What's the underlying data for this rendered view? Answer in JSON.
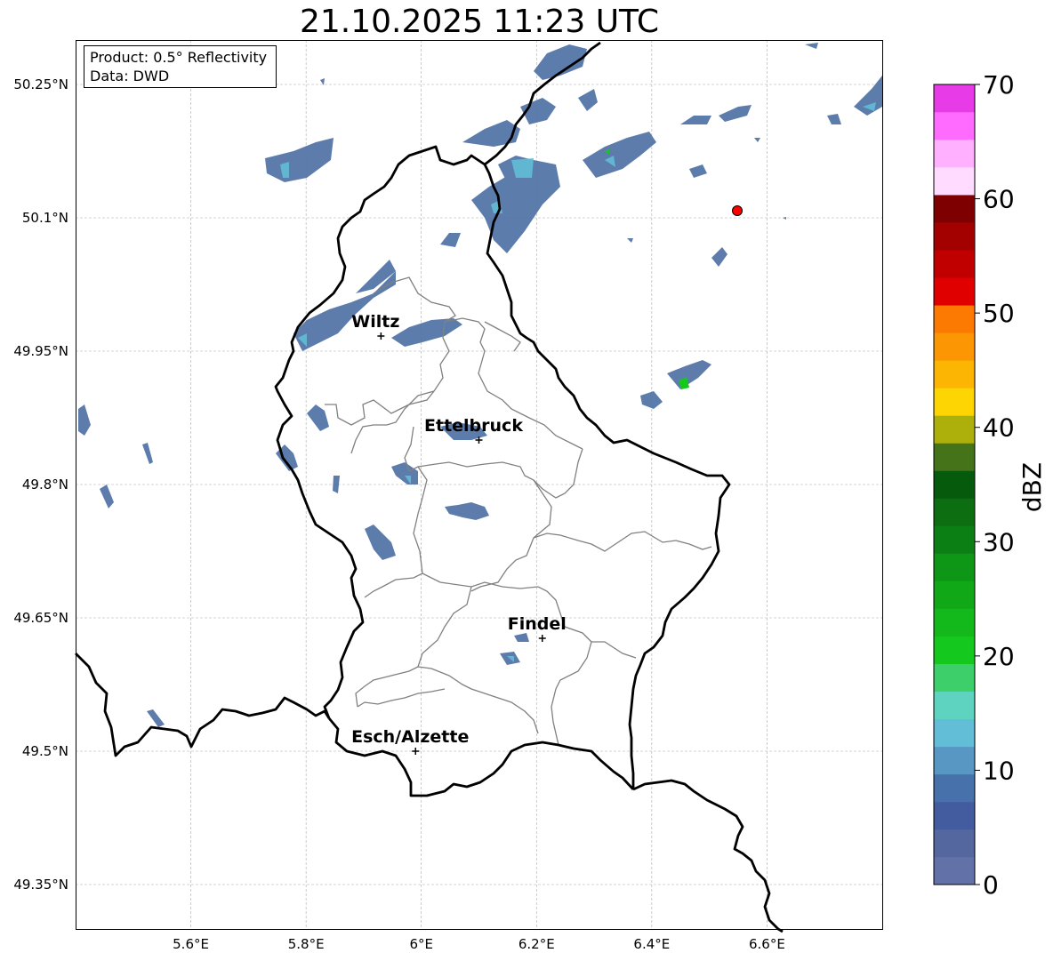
{
  "title": "21.10.2025 11:23 UTC",
  "info_box": {
    "product_line": "Product: 0.5° Reflectivity",
    "data_line": "Data: DWD"
  },
  "map": {
    "lon_range": [
      5.4,
      6.8
    ],
    "lat_range": [
      49.3,
      50.3
    ],
    "lon_ticks": [
      "5.6°E",
      "5.8°E",
      "6°E",
      "6.2°E",
      "6.4°E",
      "6.6°E"
    ],
    "lat_ticks": [
      "50.25°N",
      "50.1°N",
      "49.95°N",
      "49.8°N",
      "49.65°N",
      "49.5°N",
      "49.35°N"
    ],
    "grid": true,
    "country_border_color": "#000000",
    "district_border_color": "#808080",
    "radar_site_marker_color": "#ff0000",
    "cities": [
      {
        "name": "Wiltz",
        "lon": 5.93,
        "lat": 49.967
      },
      {
        "name": "Ettelbruck",
        "lon": 6.1,
        "lat": 49.85
      },
      {
        "name": "Findel",
        "lon": 6.21,
        "lat": 49.627
      },
      {
        "name": "Esch/Alzette",
        "lon": 5.99,
        "lat": 49.5
      }
    ]
  },
  "colorbar": {
    "label": "dBZ",
    "ticks": [
      "0",
      "10",
      "20",
      "30",
      "40",
      "50",
      "60",
      "70"
    ],
    "colors": [
      "#6272a8",
      "#54679f",
      "#425c9f",
      "#4671ab",
      "#5897c4",
      "#62bdd6",
      "#5ed3c0",
      "#3dcf6a",
      "#14c81d",
      "#13b91b",
      "#10a817",
      "#0e9617",
      "#0b7f13",
      "#0d6e11",
      "#065a0c",
      "#44731a",
      "#adb00a",
      "#fdd503",
      "#fdb504",
      "#fc9603",
      "#fc7a02",
      "#e00000",
      "#c00000",
      "#a30000",
      "#7e0000",
      "#ffdcff",
      "#ffb0ff",
      "#ff6bff",
      "#e83be8"
    ]
  }
}
